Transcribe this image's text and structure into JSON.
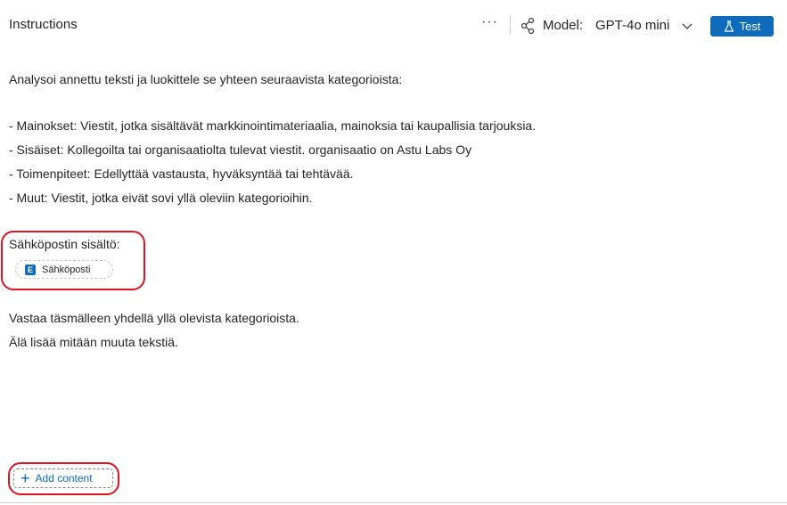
{
  "header": {
    "title": "Instructions",
    "more_label": "···",
    "model_label": "Model:",
    "model_value": "GPT-4o mini",
    "test_label": "Test"
  },
  "prompt": {
    "lines": [
      "Analysoi annettu teksti ja luokittele se yhteen seuraavista kategorioista:",
      "- Mainokset: Viestit, jotka sisältävät markkinointimateriaalia, mainoksia tai kaupallisia tarjouksia.",
      "- Sisäiset: Kollegoilta tai organisaatiolta tulevat viestit. organisaatio on Astu Labs Oy",
      "- Toimenpiteet: Edellyttää vastausta, hyväksyntää tai tehtävää.",
      "- Muut: Viestit, jotka eivät sovi yllä oleviin kategorioihin.",
      "Sähköpostin sisältö:",
      "Vastaa täsmälleen yhdellä yllä olevista kategorioista.",
      "Älä lisää mitään muuta tekstiä."
    ],
    "token_label": "Sähköposti",
    "token_icon_letter": "E"
  },
  "footer": {
    "add_content_label": "Add content"
  },
  "colors": {
    "accent": "#0f6cbd",
    "annotation": "#e0141e"
  }
}
